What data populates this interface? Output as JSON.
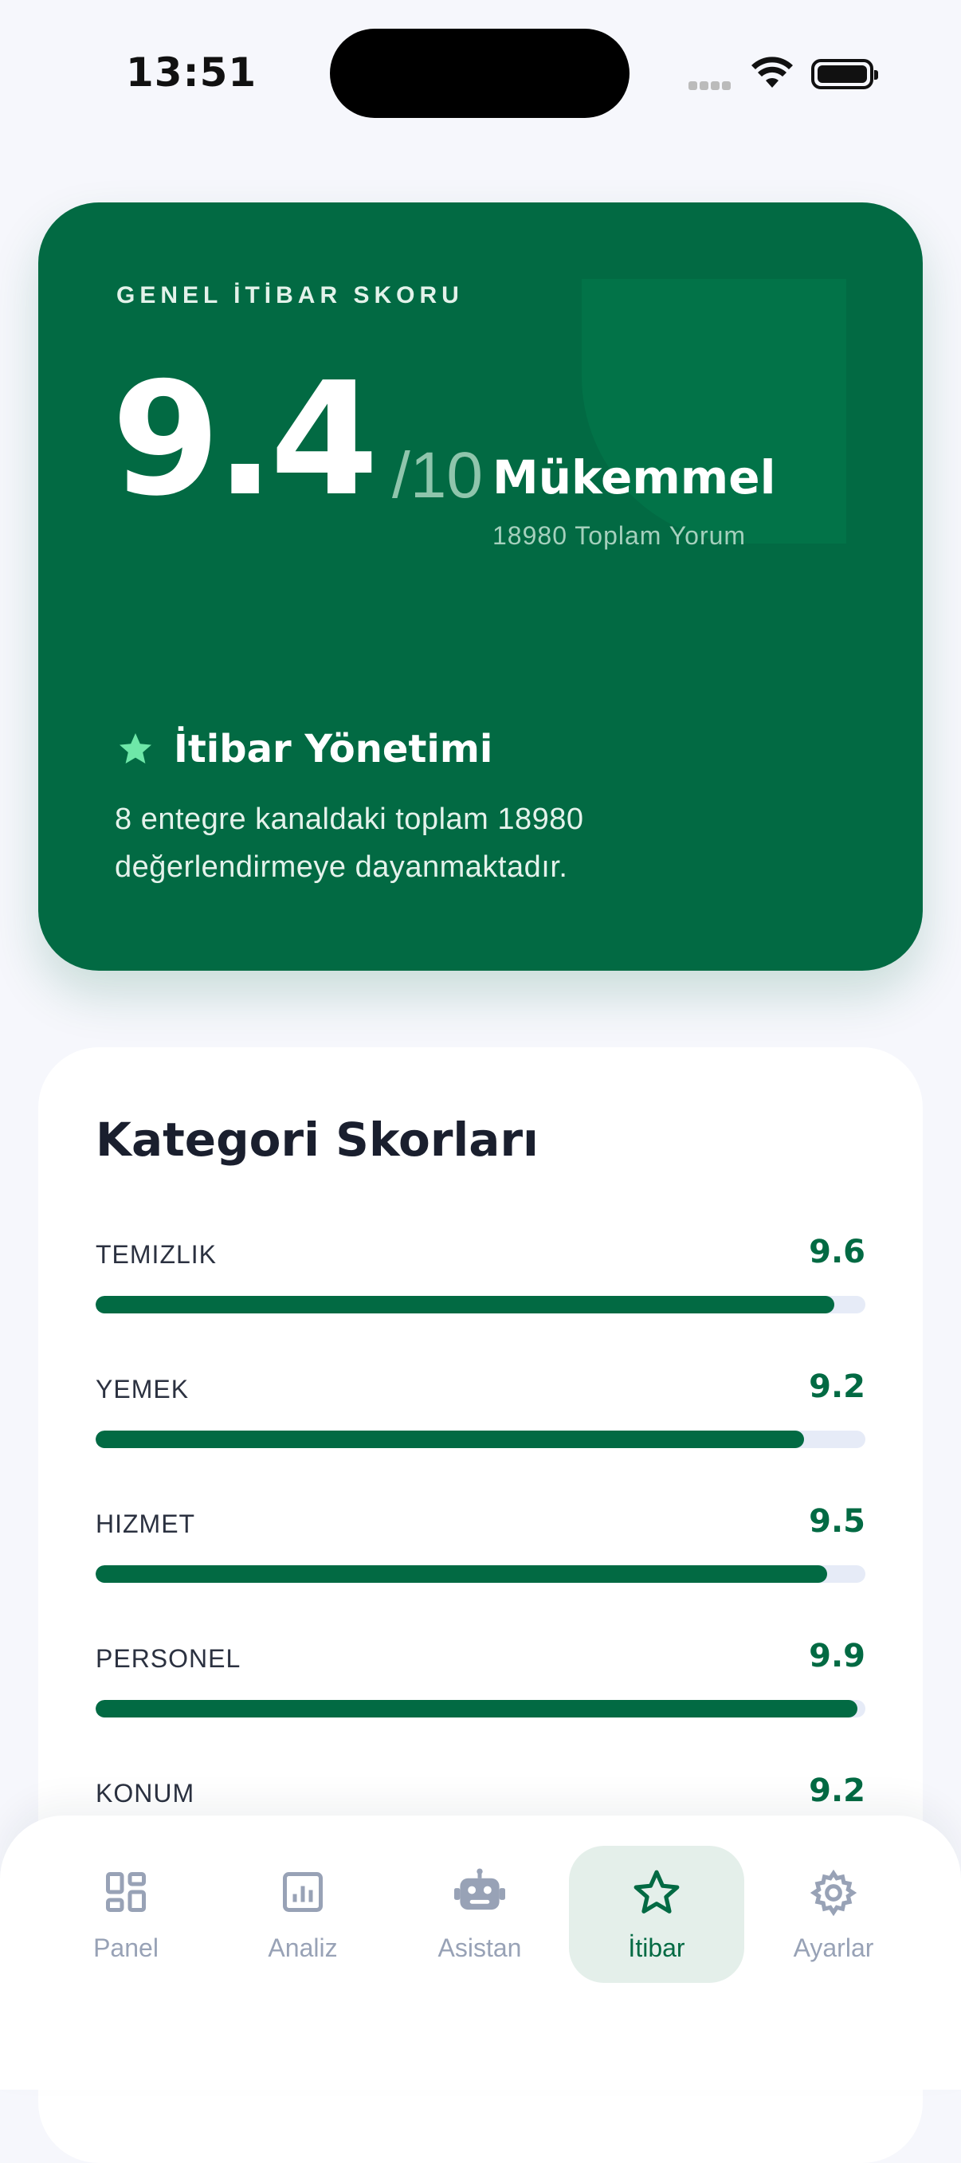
{
  "status_bar": {
    "time": "13:51"
  },
  "score_card": {
    "label": "GENEL İTİBAR SKORU",
    "score": "9.4",
    "out_of": "/10",
    "rating": "Mükemmel",
    "review_total": "18980 Toplam Yorum",
    "management_title": "İtibar Yönetimi",
    "management_desc": "8 entegre kanaldaki toplam 18980 değerlendirmeye dayanmaktadır.",
    "colors": {
      "card": "#026a43",
      "star": "#6ee7a8"
    }
  },
  "categories": {
    "title": "Kategori Skorları",
    "items": [
      {
        "name": "TEMIZLIK",
        "score": "9.6",
        "fraction": 0.96
      },
      {
        "name": "YEMEK",
        "score": "9.2",
        "fraction": 0.92
      },
      {
        "name": "HIZMET",
        "score": "9.5",
        "fraction": 0.95
      },
      {
        "name": "PERSONEL",
        "score": "9.9",
        "fraction": 0.99
      },
      {
        "name": "KONUM",
        "score": "9.2",
        "fraction": 0.92
      }
    ]
  },
  "nav": {
    "items": [
      {
        "label": "Panel",
        "icon": "dashboard-icon"
      },
      {
        "label": "Analiz",
        "icon": "chart-icon"
      },
      {
        "label": "Asistan",
        "icon": "robot-icon"
      },
      {
        "label": "İtibar",
        "icon": "star-icon",
        "active": true
      },
      {
        "label": "Ayarlar",
        "icon": "gear-icon"
      }
    ],
    "colors": {
      "active": "#026a43",
      "inactive": "#98a2b6"
    }
  }
}
